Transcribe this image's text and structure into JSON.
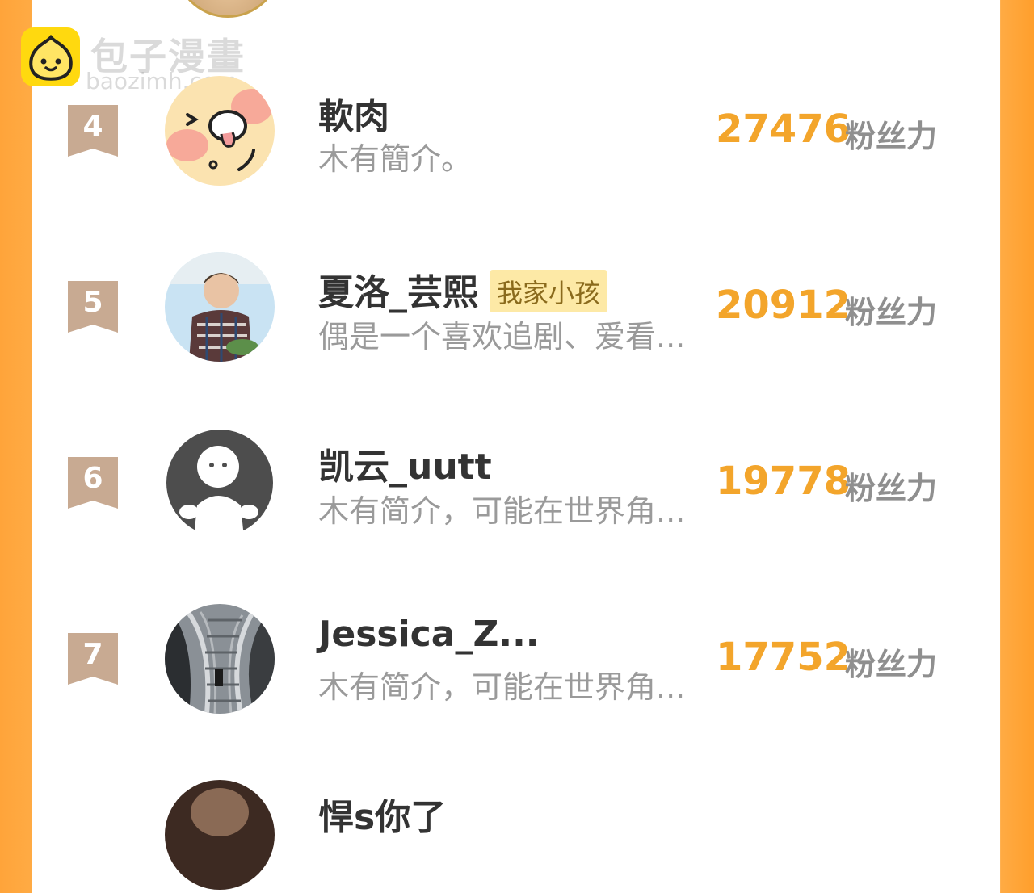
{
  "watermark": {
    "title_cn": "包子漫畫",
    "site": "baozimh.com"
  },
  "fan_unit_label": "粉丝力",
  "rankings": [
    {
      "rank": "4",
      "name": "軟肉",
      "tag": "",
      "bio": "木有簡介。",
      "score": "27476",
      "avatar_icon": "cartoon-face-icon"
    },
    {
      "rank": "5",
      "name": "夏洛_芸熙",
      "tag": "我家小孩",
      "bio": "偶是一个喜欢追剧、爱看...",
      "score": "20912",
      "avatar_icon": "child-photo-icon"
    },
    {
      "rank": "6",
      "name": "凯云_uutt",
      "tag": "",
      "bio": "木有简介，可能在世界角...",
      "score": "19778",
      "avatar_icon": "default-avatar-icon"
    },
    {
      "rank": "7",
      "name": "Jessica_Z...",
      "tag": "",
      "bio": "木有简介，可能在世界角...",
      "score": "17752",
      "avatar_icon": "stairs-photo-icon"
    },
    {
      "rank": "",
      "name": "悍s你了",
      "tag": "",
      "bio": "",
      "score": "",
      "avatar_icon": "portrait-photo-icon"
    }
  ],
  "colors": {
    "accent_orange": "#f3a52b",
    "rank_badge": "#c8aa92",
    "tag_background": "#fde9a6",
    "frame_orange": "#ffa43a"
  }
}
